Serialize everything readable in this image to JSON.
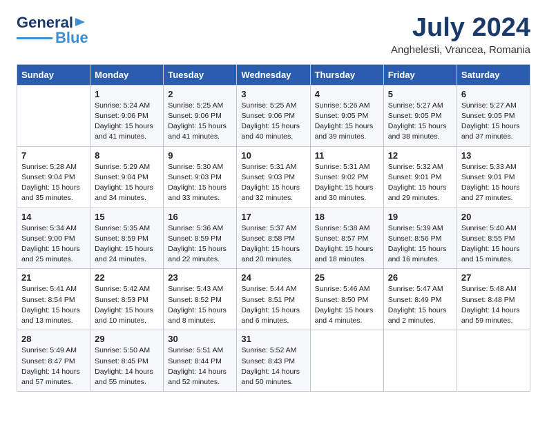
{
  "header": {
    "logo_line1": "General",
    "logo_line2": "Blue",
    "title": "July 2024",
    "subtitle": "Anghelesti, Vrancea, Romania"
  },
  "calendar": {
    "days_of_week": [
      "Sunday",
      "Monday",
      "Tuesday",
      "Wednesday",
      "Thursday",
      "Friday",
      "Saturday"
    ],
    "weeks": [
      [
        {
          "day": "",
          "info": ""
        },
        {
          "day": "1",
          "info": "Sunrise: 5:24 AM\nSunset: 9:06 PM\nDaylight: 15 hours\nand 41 minutes."
        },
        {
          "day": "2",
          "info": "Sunrise: 5:25 AM\nSunset: 9:06 PM\nDaylight: 15 hours\nand 41 minutes."
        },
        {
          "day": "3",
          "info": "Sunrise: 5:25 AM\nSunset: 9:06 PM\nDaylight: 15 hours\nand 40 minutes."
        },
        {
          "day": "4",
          "info": "Sunrise: 5:26 AM\nSunset: 9:05 PM\nDaylight: 15 hours\nand 39 minutes."
        },
        {
          "day": "5",
          "info": "Sunrise: 5:27 AM\nSunset: 9:05 PM\nDaylight: 15 hours\nand 38 minutes."
        },
        {
          "day": "6",
          "info": "Sunrise: 5:27 AM\nSunset: 9:05 PM\nDaylight: 15 hours\nand 37 minutes."
        }
      ],
      [
        {
          "day": "7",
          "info": "Sunrise: 5:28 AM\nSunset: 9:04 PM\nDaylight: 15 hours\nand 35 minutes."
        },
        {
          "day": "8",
          "info": "Sunrise: 5:29 AM\nSunset: 9:04 PM\nDaylight: 15 hours\nand 34 minutes."
        },
        {
          "day": "9",
          "info": "Sunrise: 5:30 AM\nSunset: 9:03 PM\nDaylight: 15 hours\nand 33 minutes."
        },
        {
          "day": "10",
          "info": "Sunrise: 5:31 AM\nSunset: 9:03 PM\nDaylight: 15 hours\nand 32 minutes."
        },
        {
          "day": "11",
          "info": "Sunrise: 5:31 AM\nSunset: 9:02 PM\nDaylight: 15 hours\nand 30 minutes."
        },
        {
          "day": "12",
          "info": "Sunrise: 5:32 AM\nSunset: 9:01 PM\nDaylight: 15 hours\nand 29 minutes."
        },
        {
          "day": "13",
          "info": "Sunrise: 5:33 AM\nSunset: 9:01 PM\nDaylight: 15 hours\nand 27 minutes."
        }
      ],
      [
        {
          "day": "14",
          "info": "Sunrise: 5:34 AM\nSunset: 9:00 PM\nDaylight: 15 hours\nand 25 minutes."
        },
        {
          "day": "15",
          "info": "Sunrise: 5:35 AM\nSunset: 8:59 PM\nDaylight: 15 hours\nand 24 minutes."
        },
        {
          "day": "16",
          "info": "Sunrise: 5:36 AM\nSunset: 8:59 PM\nDaylight: 15 hours\nand 22 minutes."
        },
        {
          "day": "17",
          "info": "Sunrise: 5:37 AM\nSunset: 8:58 PM\nDaylight: 15 hours\nand 20 minutes."
        },
        {
          "day": "18",
          "info": "Sunrise: 5:38 AM\nSunset: 8:57 PM\nDaylight: 15 hours\nand 18 minutes."
        },
        {
          "day": "19",
          "info": "Sunrise: 5:39 AM\nSunset: 8:56 PM\nDaylight: 15 hours\nand 16 minutes."
        },
        {
          "day": "20",
          "info": "Sunrise: 5:40 AM\nSunset: 8:55 PM\nDaylight: 15 hours\nand 15 minutes."
        }
      ],
      [
        {
          "day": "21",
          "info": "Sunrise: 5:41 AM\nSunset: 8:54 PM\nDaylight: 15 hours\nand 13 minutes."
        },
        {
          "day": "22",
          "info": "Sunrise: 5:42 AM\nSunset: 8:53 PM\nDaylight: 15 hours\nand 10 minutes."
        },
        {
          "day": "23",
          "info": "Sunrise: 5:43 AM\nSunset: 8:52 PM\nDaylight: 15 hours\nand 8 minutes."
        },
        {
          "day": "24",
          "info": "Sunrise: 5:44 AM\nSunset: 8:51 PM\nDaylight: 15 hours\nand 6 minutes."
        },
        {
          "day": "25",
          "info": "Sunrise: 5:46 AM\nSunset: 8:50 PM\nDaylight: 15 hours\nand 4 minutes."
        },
        {
          "day": "26",
          "info": "Sunrise: 5:47 AM\nSunset: 8:49 PM\nDaylight: 15 hours\nand 2 minutes."
        },
        {
          "day": "27",
          "info": "Sunrise: 5:48 AM\nSunset: 8:48 PM\nDaylight: 14 hours\nand 59 minutes."
        }
      ],
      [
        {
          "day": "28",
          "info": "Sunrise: 5:49 AM\nSunset: 8:47 PM\nDaylight: 14 hours\nand 57 minutes."
        },
        {
          "day": "29",
          "info": "Sunrise: 5:50 AM\nSunset: 8:45 PM\nDaylight: 14 hours\nand 55 minutes."
        },
        {
          "day": "30",
          "info": "Sunrise: 5:51 AM\nSunset: 8:44 PM\nDaylight: 14 hours\nand 52 minutes."
        },
        {
          "day": "31",
          "info": "Sunrise: 5:52 AM\nSunset: 8:43 PM\nDaylight: 14 hours\nand 50 minutes."
        },
        {
          "day": "",
          "info": ""
        },
        {
          "day": "",
          "info": ""
        },
        {
          "day": "",
          "info": ""
        }
      ]
    ]
  }
}
